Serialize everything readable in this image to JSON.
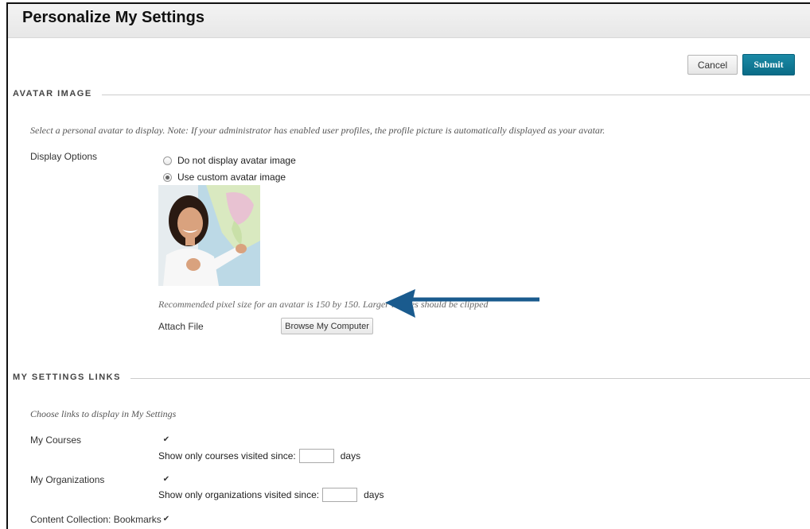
{
  "page": {
    "title": "Personalize My Settings"
  },
  "actions": {
    "cancel_label": "Cancel",
    "submit_label": "Submit"
  },
  "avatar_section": {
    "heading": "AVATAR IMAGE",
    "instructions": "Select a personal avatar to display. Note: If your administrator has enabled user profiles, the profile picture is automatically displayed as your avatar.",
    "display_options_label": "Display Options",
    "options": [
      {
        "label": "Do not display avatar image",
        "selected": false
      },
      {
        "label": "Use custom avatar image",
        "selected": true
      }
    ],
    "recommendation": "Recommended pixel size for an avatar is 150 by 150. Larger images should be clipped",
    "attach_label": "Attach File",
    "browse_label": "Browse My Computer"
  },
  "links_section": {
    "heading": "MY SETTINGS LINKS",
    "instructions": "Choose links to display in My Settings",
    "items": [
      {
        "label": "My Courses",
        "checked": true,
        "filter_text": "Show only courses visited since:",
        "filter_value": "",
        "unit": "days"
      },
      {
        "label": "My Organizations",
        "checked": true,
        "filter_text": "Show only organizations visited since:",
        "filter_value": "",
        "unit": "days"
      },
      {
        "label": "Content Collection: Bookmarks",
        "checked": true
      }
    ]
  },
  "colors": {
    "accent": "#0a6c87",
    "arrow": "#1a5b8e"
  }
}
